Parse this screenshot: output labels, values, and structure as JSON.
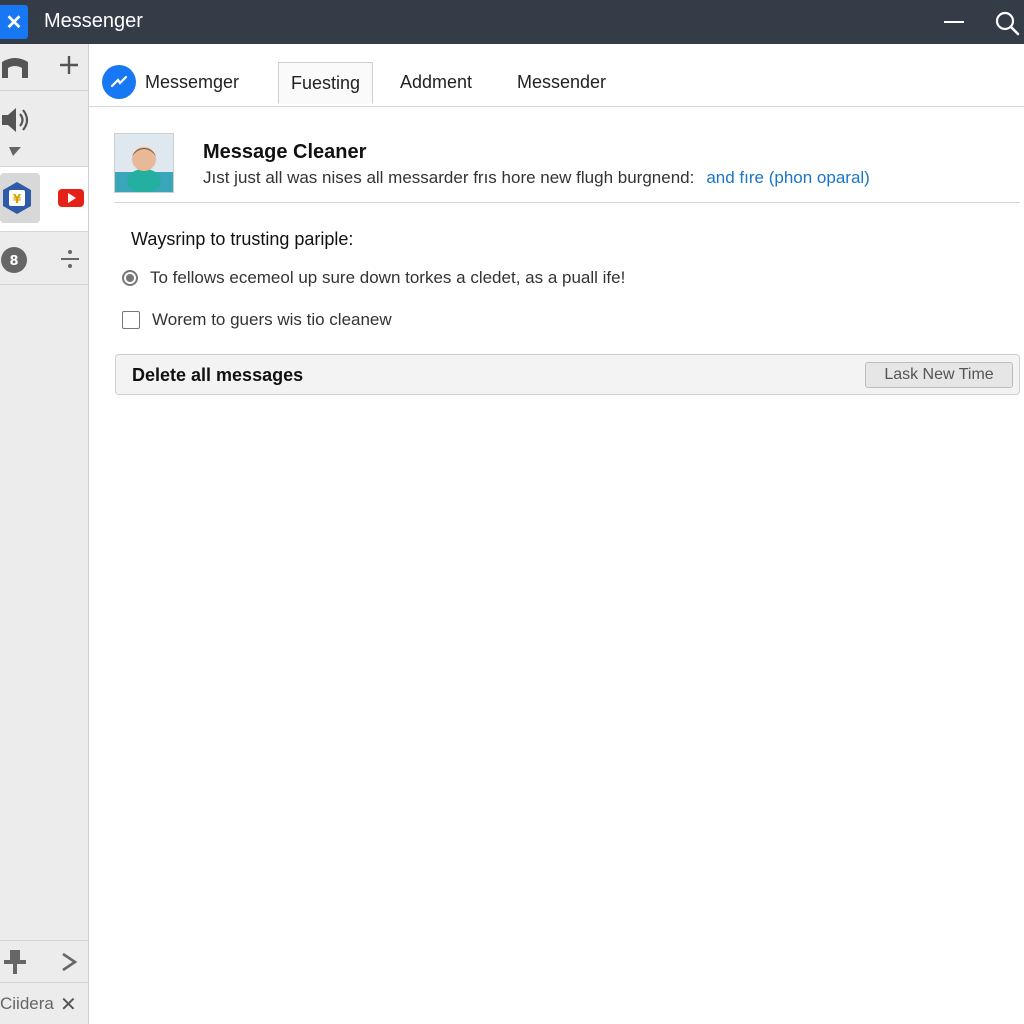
{
  "window": {
    "title": "Messenger",
    "app_icon": "close-x-icon"
  },
  "sidebar": {
    "items": [
      {
        "icon": "bridge-icon",
        "secondary_icon": "plus-icon"
      },
      {
        "icon": "speaker-icon",
        "secondary_icon": "small-arrow-icon"
      },
      {
        "icon": "badge-app-icon",
        "secondary_icon": "youtube-icon",
        "active": true
      },
      {
        "icon": "coin-icon",
        "secondary_icon": "divide-icon"
      }
    ],
    "bottom": {
      "label": "Ciidera",
      "close": "✕"
    }
  },
  "tabs": [
    {
      "label": "Messemger"
    },
    {
      "label": "Fuesting",
      "active": true
    },
    {
      "label": "Addment"
    },
    {
      "label": "Messender"
    }
  ],
  "header": {
    "title": "Message Cleaner",
    "description": "Jıst just all was nises all messarder frıs hore new flugh burgnend:",
    "link_text": "and fıre (phon oparal)"
  },
  "options": {
    "section_title": "Waysrinp to trusting pariple:",
    "radio_label": "To fellows ecemeol up sure down torkes a cledet, as a puall ife!",
    "checkbox_label": "Worem to guers wis tio cleanew"
  },
  "action": {
    "label": "Delete all messages",
    "button": "Lask  New Time"
  },
  "colors": {
    "titlebar": "#343c48",
    "accent": "#1877f2",
    "link": "#1a76c9",
    "youtube": "#e62117"
  }
}
